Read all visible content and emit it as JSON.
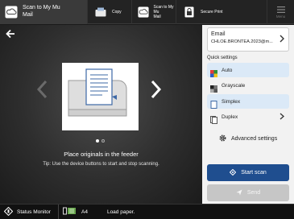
{
  "topbar": {
    "active_tab": {
      "label_line1": "Scan to My Mu",
      "label_line2": "Mail",
      "icon": "cloud-scan-icon"
    },
    "tabs": [
      {
        "label": "Copy",
        "icon": "copy-icon"
      },
      {
        "label_line1": "Scan to My Mu",
        "label_line2": "Mail",
        "icon": "cloud-scan-icon"
      },
      {
        "label": "Secure Print",
        "icon": "secure-print-icon"
      }
    ],
    "menu_label": "Menu"
  },
  "main": {
    "instruction": "Place originals in the feeder",
    "tip": "Tip: Use the device buttons to start and stop scanning.",
    "pager": {
      "total": 2,
      "current": 1
    }
  },
  "panel": {
    "email": {
      "title": "Email",
      "address": "CHLOE.BRONTEA.2023@m..."
    },
    "quick_settings_label": "Quick settings",
    "options": [
      {
        "label": "Auto",
        "selected": true,
        "icon": "color-auto-icon"
      },
      {
        "label": "Grayscale",
        "selected": false,
        "icon": "grayscale-icon"
      },
      {
        "label": "Simplex",
        "selected": true,
        "icon": "simplex-icon"
      },
      {
        "label": "Duplex",
        "selected": false,
        "icon": "duplex-icon"
      }
    ],
    "advanced_label": "Advanced settings",
    "start_scan_label": "Start scan",
    "send_label": "Send"
  },
  "status": {
    "monitor_label": "Status Monitor",
    "paper_size": "A4",
    "message": "Load paper."
  },
  "colors": {
    "primary": "#1f4e8f",
    "selected_bg": "#dbe9f7",
    "disabled": "#c6c6c6"
  }
}
